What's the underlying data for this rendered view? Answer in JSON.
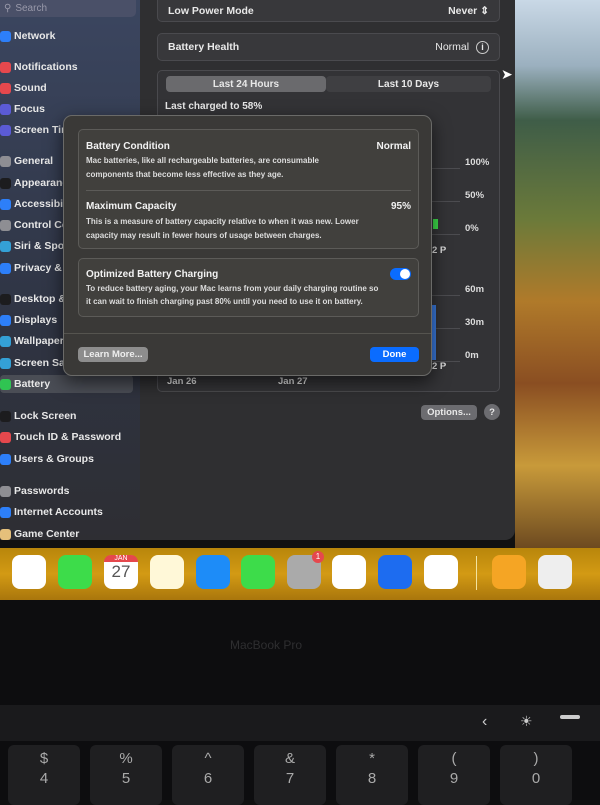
{
  "sidebar": {
    "search_placeholder": "Search",
    "items": [
      {
        "label": "Network",
        "color": "#2d7ff9"
      },
      {
        "label": "Notifications",
        "color": "#e5484d"
      },
      {
        "label": "Sound",
        "color": "#e5484d"
      },
      {
        "label": "Focus",
        "color": "#5b5bd6"
      },
      {
        "label": "Screen Tim",
        "color": "#5b5bd6"
      },
      {
        "label": "General",
        "color": "#8e8e93"
      },
      {
        "label": "Appearanc",
        "color": "#1c1c1e"
      },
      {
        "label": "Accessibilit",
        "color": "#2d7ff9"
      },
      {
        "label": "Control Ce",
        "color": "#8e8e93"
      },
      {
        "label": "Siri & Spoti",
        "color": "#34a0d6"
      },
      {
        "label": "Privacy & S",
        "color": "#2d7ff9"
      },
      {
        "label": "Desktop &",
        "color": "#1c1c1e"
      },
      {
        "label": "Displays",
        "color": "#2d7ff9"
      },
      {
        "label": "Wallpaper",
        "color": "#34a0d6"
      },
      {
        "label": "Screen Sav",
        "color": "#34a0d6"
      },
      {
        "label": "Battery",
        "color": "#30c452"
      },
      {
        "label": "Lock Screen",
        "color": "#1c1c1e"
      },
      {
        "label": "Touch ID & Password",
        "color": "#e5484d"
      },
      {
        "label": "Users & Groups",
        "color": "#2d7ff9"
      },
      {
        "label": "Passwords",
        "color": "#8e8e93"
      },
      {
        "label": "Internet Accounts",
        "color": "#2d7ff9"
      },
      {
        "label": "Game Center",
        "color": "#e5c07b"
      }
    ],
    "selected": "Battery"
  },
  "main": {
    "low_power": {
      "label": "Low Power Mode",
      "value": "Never"
    },
    "battery_health": {
      "label": "Battery Health",
      "value": "Normal"
    },
    "tabs": [
      {
        "label": "Last 24 Hours",
        "selected": true
      },
      {
        "label": "Last 10 Days",
        "selected": false
      }
    ],
    "last_charged": "Last charged to 58%",
    "level_axis": [
      "100%",
      "50%",
      "0%"
    ],
    "usage_axis": [
      "60m",
      "30m",
      "0m"
    ],
    "time_fragment": "2 P",
    "dates": [
      "Jan 26",
      "Jan 27"
    ],
    "options_label": "Options...",
    "help_label": "?"
  },
  "dialog": {
    "condition_title": "Battery Condition",
    "condition_value": "Normal",
    "condition_desc_1": "Mac batteries, like all rechargeable batteries, are consumable",
    "condition_desc_2": "components that become less effective as they age.",
    "capacity_title": "Maximum Capacity",
    "capacity_value": "95%",
    "capacity_desc_1": "This is a measure of battery capacity relative to when it was new. Lower",
    "capacity_desc_2": "capacity may result in fewer hours of usage between charges.",
    "optimized_title": "Optimized Battery Charging",
    "optimized_enabled": true,
    "optimized_desc_1": "To reduce battery aging, your Mac learns from your daily charging routine so",
    "optimized_desc_2": "it can wait to finish charging past 80% until you need to use it on battery.",
    "learn_more": "Learn More...",
    "done": "Done",
    "accent": "#0a6cff"
  },
  "dock": {
    "apps": [
      "photos",
      "facetime",
      "calendar",
      "notes",
      "app-store",
      "whatsapp",
      "system-settings",
      "chrome",
      "xcode",
      "teams",
      "pages",
      "script-editor"
    ],
    "calendar_month": "JAN",
    "calendar_day": "27",
    "settings_badge": "1"
  },
  "laptop": {
    "model": "MacBook Pro",
    "keys": [
      [
        "$",
        "4"
      ],
      [
        "%",
        "5"
      ],
      [
        "^",
        "6"
      ],
      [
        "&",
        "7"
      ],
      [
        "*",
        "8"
      ],
      [
        "(",
        "9"
      ],
      [
        ")",
        "0"
      ]
    ]
  }
}
